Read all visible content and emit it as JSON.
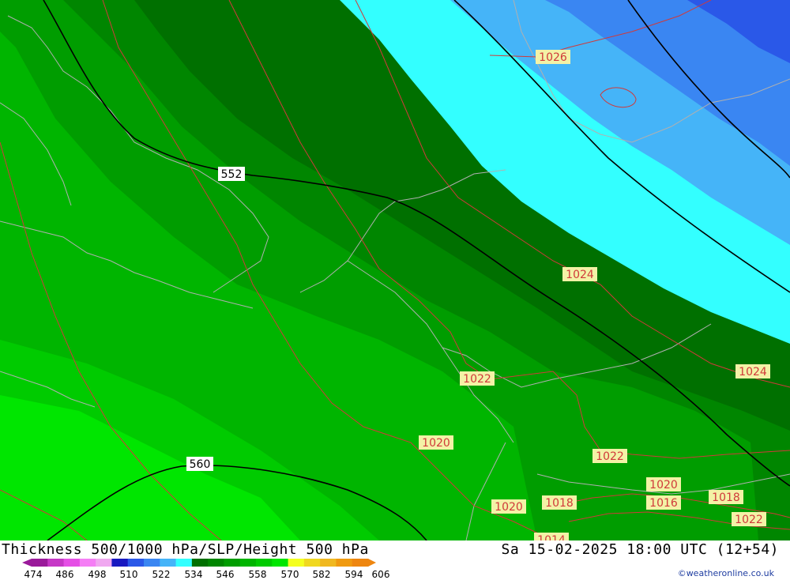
{
  "map": {
    "slp_labels": [
      "1026",
      "1024",
      "1024",
      "1022",
      "1022",
      "1020",
      "1020",
      "1020",
      "1018",
      "1016",
      "1018",
      "1022",
      "1014"
    ],
    "height_labels": [
      "552",
      "560"
    ],
    "colors": {
      "band_474": "#c638c6",
      "band_480": "#e54fe5",
      "band_486": "#f57ef5",
      "band_498": "#2020c8",
      "band_504": "#2a58e8",
      "band_510": "#3a86f2",
      "band_516": "#45b4f8",
      "band_522": "#33ffff",
      "band_528": "#007000",
      "band_534": "#008600",
      "band_540": "#009d00",
      "band_546": "#00b500",
      "band_552": "#00cb00",
      "band_558": "#00e600",
      "band_564": "#f4ff20",
      "band_570": "#f0d820",
      "band_576": "#f0b820",
      "band_582": "#f09a10",
      "band_588": "#ee8610",
      "slp_contour": "#d03a3a",
      "coastline": "#b0b0b0",
      "height_contour": "#000000"
    }
  },
  "footer": {
    "title": "Thickness 500/1000 hPa/SLP/Height 500 hPa",
    "valid": "Sa 15-02-2025 18:00 UTC (12+54)",
    "credit": "©weatheronline.co.uk",
    "colorbar_ticks": [
      "474",
      "486",
      "498",
      "510",
      "522",
      "534",
      "546",
      "558",
      "570",
      "582",
      "594",
      "606"
    ],
    "colorbar_colors": [
      "#9a1a9a",
      "#c638c6",
      "#e54fe5",
      "#f57ef5",
      "#f0a8f0",
      "#1818c0",
      "#2a58e8",
      "#3a86f2",
      "#45b4f8",
      "#33ffff",
      "#007000",
      "#008600",
      "#009d00",
      "#00b500",
      "#00cb00",
      "#00e600",
      "#f4ff20",
      "#f0d820",
      "#f0b820",
      "#f09a10",
      "#ee8610"
    ]
  }
}
